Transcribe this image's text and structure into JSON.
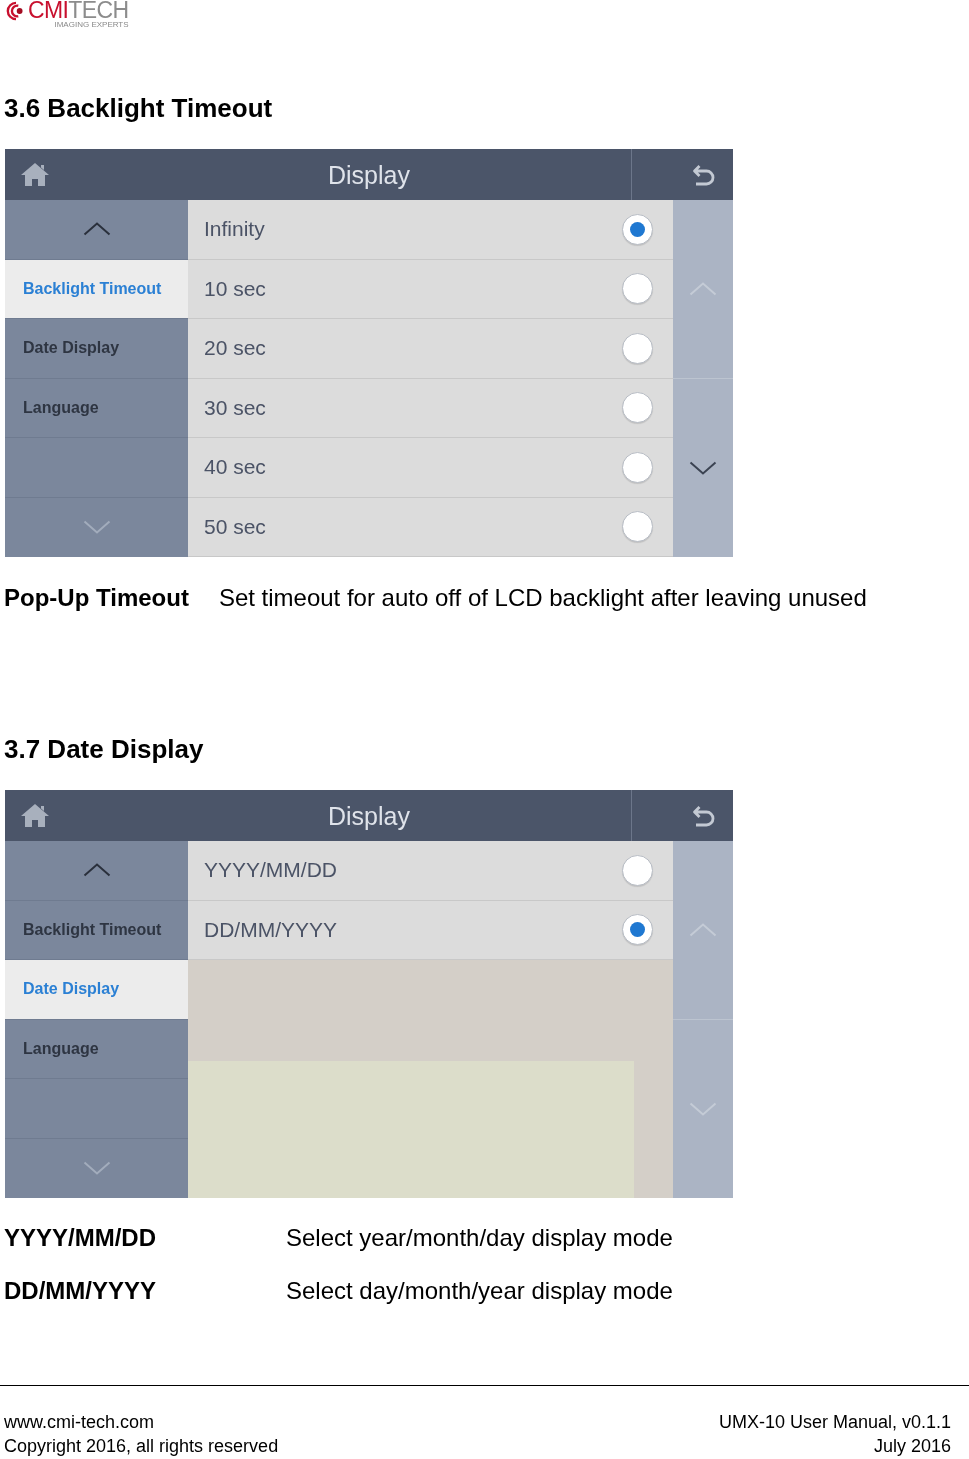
{
  "logo": {
    "wordmark": [
      "CMI",
      "TECH"
    ],
    "tagline": "IMAGING EXPERTS"
  },
  "sections": [
    {
      "heading": "3.6 Backlight Timeout",
      "screen": {
        "title": "Display",
        "sidebar": {
          "scroll_up": {
            "disabled": false
          },
          "items": [
            {
              "label": "Backlight Timeout",
              "selected": true
            },
            {
              "label": "Date Display",
              "selected": false
            },
            {
              "label": "Language",
              "selected": false
            }
          ],
          "scroll_down": {
            "disabled": true
          }
        },
        "options": [
          {
            "label": "Infinity",
            "selected": true
          },
          {
            "label": "10 sec",
            "selected": false
          },
          {
            "label": "20 sec",
            "selected": false
          },
          {
            "label": "30 sec",
            "selected": false
          },
          {
            "label": "40 sec",
            "selected": false
          },
          {
            "label": "50 sec",
            "selected": false
          }
        ],
        "scroll": {
          "up": {
            "disabled": true
          },
          "down": {
            "disabled": false
          }
        }
      },
      "definitions": [
        {
          "term": "Pop-Up Timeout",
          "description": "Set timeout for auto off of LCD backlight after leaving unused"
        }
      ]
    },
    {
      "heading": "3.7 Date Display",
      "screen": {
        "title": "Display",
        "sidebar": {
          "scroll_up": {
            "disabled": false
          },
          "items": [
            {
              "label": "Backlight Timeout",
              "selected": false
            },
            {
              "label": "Date Display",
              "selected": true
            },
            {
              "label": "Language",
              "selected": false
            }
          ],
          "scroll_down": {
            "disabled": true
          }
        },
        "options": [
          {
            "label": "YYYY/MM/DD",
            "selected": false
          },
          {
            "label": "DD/MM/YYYY",
            "selected": true
          }
        ],
        "scroll": {
          "up": {
            "disabled": true
          },
          "down": {
            "disabled": true
          }
        }
      },
      "definitions": [
        {
          "term": "YYYY/MM/DD",
          "description": "Select year/month/day display mode"
        },
        {
          "term": "DD/MM/YYYY",
          "description": "Select day/month/year display mode"
        }
      ]
    }
  ],
  "footer": {
    "left": [
      "www.cmi-tech.com",
      "Copyright 2016, all rights reserved"
    ],
    "right": [
      "UMX-10 User Manual, v0.1.1",
      "July 2016"
    ]
  }
}
